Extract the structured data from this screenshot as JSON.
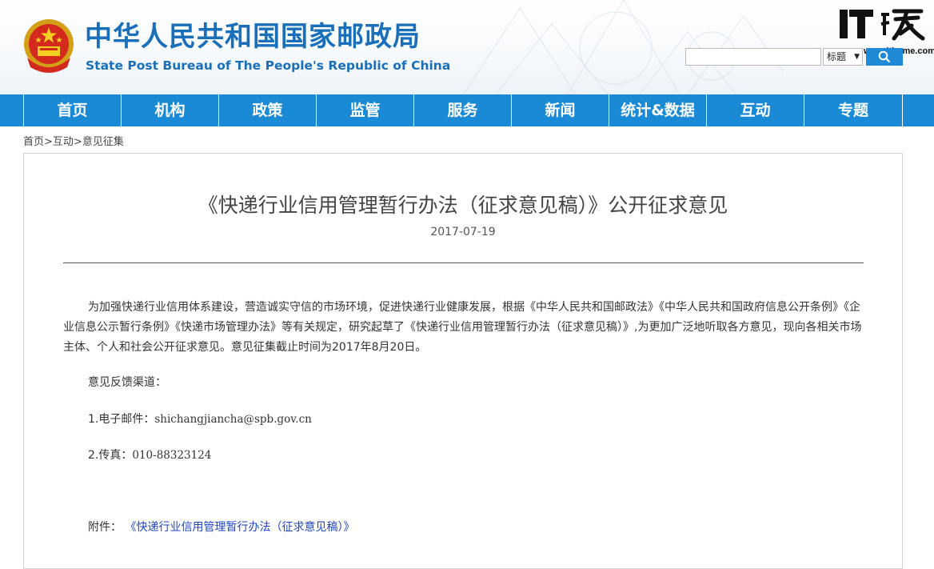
{
  "header": {
    "title_cn": "中华人民共和国国家邮政局",
    "title_en": "State Post Bureau of The People's Republic of China",
    "watermark_url": "www.ithome.com"
  },
  "search": {
    "value": "",
    "select_value": "标题",
    "button_icon": "search-icon"
  },
  "nav": {
    "items": [
      {
        "label": "首页"
      },
      {
        "label": "机构"
      },
      {
        "label": "政策"
      },
      {
        "label": "监管"
      },
      {
        "label": "服务"
      },
      {
        "label": "新闻"
      },
      {
        "label": "统计&数据"
      },
      {
        "label": "互动"
      },
      {
        "label": "专题"
      }
    ]
  },
  "breadcrumb": {
    "home": "首页",
    "sep1": ">",
    "section": "互动",
    "sep2": ">",
    "current": "意见征集"
  },
  "article": {
    "title": "《快递行业信用管理暂行办法（征求意见稿）》公开征求意见",
    "date": "2017-07-19",
    "paragraph": "为加强快递行业信用体系建设，营造诚实守信的市场环境，促进快递行业健康发展，根据《中华人民共和国邮政法》《中华人民共和国政府信息公开条例》《企业信息公示暂行条例》《快递市场管理办法》等有关规定，研究起草了《快递行业信用管理暂行办法（征求意见稿）》,为更加广泛地听取各方意见，现向各相关市场主体、个人和社会公开征求意见。意见征集截止时间为2017年8月20日。",
    "feedback_heading": "意见反馈渠道：",
    "email_label": "1.电子邮件：",
    "email_value": "shichangjiancha@spb.gov.cn",
    "fax_label": "2.传真：",
    "fax_value": "010-88323124",
    "attachment_label": "附件：",
    "attachment_link": "《快递行业信用管理暂行办法（征求意见稿）》"
  },
  "colors": {
    "brand_blue": "#1a6fba",
    "nav_blue": "#1a8ad6",
    "link_blue": "#1d46c4"
  }
}
